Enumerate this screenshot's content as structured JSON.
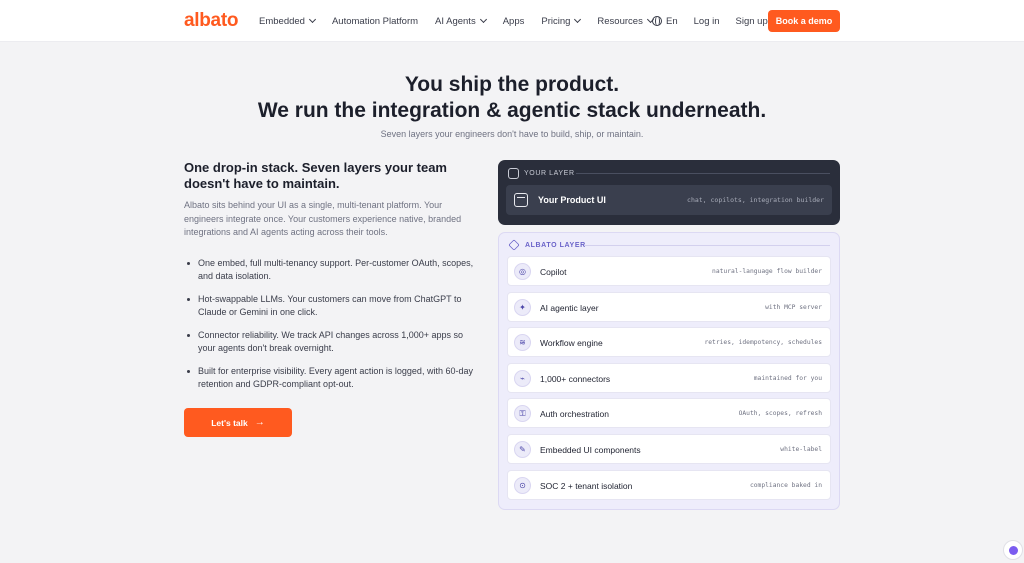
{
  "header": {
    "logo": "albato",
    "nav": [
      "Embedded",
      "Automation Platform",
      "AI Agents",
      "Apps",
      "Pricing",
      "Resources"
    ],
    "lang": "En",
    "login": "Log in",
    "signup": "Sign up",
    "demo": "Book a demo"
  },
  "hero": {
    "title_line1": "You ship the product.",
    "title_line2": "We run the integration & agentic stack underneath.",
    "subtitle": "Seven layers your engineers don't have to build, ship, or maintain."
  },
  "left": {
    "heading": "One drop-in stack. Seven layers your team doesn't have to maintain.",
    "paragraph": "Albato sits behind your UI as a single, multi-tenant platform. Your engineers integrate once. Your customers experience native, branded integrations and AI agents acting across their tools.",
    "bullets": [
      "One embed, full multi-tenancy support. Per-customer OAuth, scopes, and data isolation.",
      "Hot-swappable LLMs. Your customers can move from ChatGPT to Claude or Gemini in one click.",
      "Connector reliability. We track API changes across 1,000+ apps so your agents don't break overnight.",
      "Built for enterprise visibility. Every agent action is logged, with 60-day retention and GDPR-compliant opt-out."
    ],
    "cta": "Let's talk"
  },
  "your_layer": {
    "label": "YOUR LAYER",
    "title": "Your Product UI",
    "meta": "chat, copilots, integration builder"
  },
  "albato_layer": {
    "label": "ALBATO LAYER",
    "items": [
      {
        "title": "Copilot",
        "meta": "natural-language flow builder",
        "icon": "copilot-icon"
      },
      {
        "title": "AI agentic layer",
        "meta": "with MCP server",
        "icon": "ai-icon"
      },
      {
        "title": "Workflow engine",
        "meta": "retries, idempotency, schedules",
        "icon": "workflow-icon"
      },
      {
        "title": "1,000+ connectors",
        "meta": "maintained for you",
        "icon": "plug-icon"
      },
      {
        "title": "Auth orchestration",
        "meta": "OAuth, scopes, refresh",
        "icon": "key-icon"
      },
      {
        "title": "Embedded UI components",
        "meta": "white-label",
        "icon": "brush-icon"
      },
      {
        "title": "SOC 2 + tenant isolation",
        "meta": "compliance baked in",
        "icon": "lock-icon"
      }
    ]
  },
  "colors": {
    "accent": "#ff5a1f",
    "dark_card": "#2a2e3b",
    "layer_bg": "#eeedfb",
    "layer_accent": "#6a63c9"
  }
}
